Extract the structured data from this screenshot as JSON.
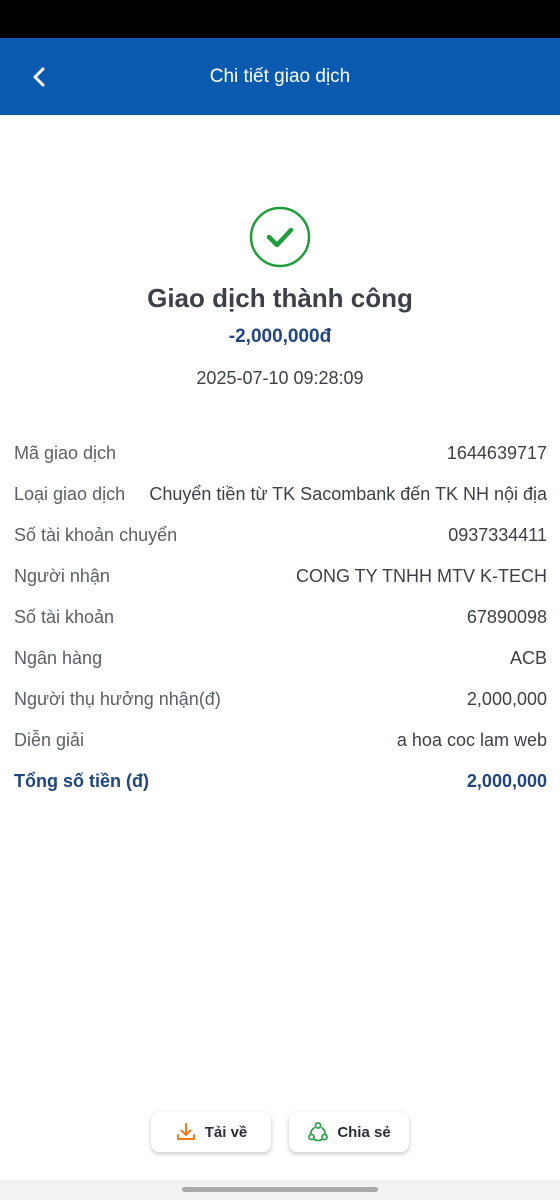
{
  "header": {
    "title": "Chi tiết giao dịch"
  },
  "result": {
    "title": "Giao dịch thành công",
    "amount": "-2,000,000đ",
    "datetime": "2025-07-10 09:28:09"
  },
  "details": [
    {
      "label": "Mã giao dịch",
      "value": "1644639717"
    },
    {
      "label": "Loại giao dịch",
      "value": "Chuyển tiền từ TK Sacombank đến TK NH nội địa"
    },
    {
      "label": "Số tài khoản chuyển",
      "value": "0937334411"
    },
    {
      "label": "Người nhận",
      "value": "CONG TY TNHH MTV K-TECH"
    },
    {
      "label": "Số tài khoản",
      "value": "67890098"
    },
    {
      "label": "Ngân hàng",
      "value": "ACB"
    },
    {
      "label": "Người thụ hưởng nhận(đ)",
      "value": "2,000,000"
    },
    {
      "label": "Diễn giải",
      "value": "a hoa coc lam web"
    }
  ],
  "total": {
    "label": "Tổng số tiền (đ)",
    "value": "2,000,000"
  },
  "actions": {
    "download_label": "Tải về",
    "share_label": "Chia sẻ"
  },
  "colors": {
    "header_bg": "#0a5bb0",
    "success_green": "#1f9d3a",
    "amount_blue": "#21457e",
    "download_orange": "#f07b1f"
  },
  "icons": {
    "back": "chevron-left-icon",
    "success": "check-circle-icon",
    "download": "download-icon",
    "share": "share-icon"
  }
}
